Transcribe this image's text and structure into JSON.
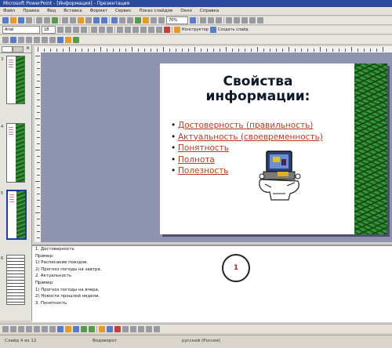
{
  "window": {
    "title": "Microsoft PowerPoint - [Информация] - Презентация"
  },
  "menu": [
    "Файл",
    "Правка",
    "Вид",
    "Вставка",
    "Формат",
    "Сервис",
    "Показ слайдов",
    "Окно",
    "Справка"
  ],
  "toolbar": {
    "zoom": "70%",
    "font": "Arial",
    "font_size": "18",
    "design_label": "Конструктор",
    "new_slide_label": "Создать слайд"
  },
  "left_panel": {
    "slide_numbers": [
      "3",
      "4",
      "5",
      "6"
    ]
  },
  "slide": {
    "title_line1": "Свойства",
    "title_line2": "информации:",
    "bullets": [
      "Достоверность (правильность)",
      "Актуальность (своевременность)",
      "Понятность",
      "Полнота",
      "Полезность"
    ]
  },
  "notes": {
    "lines": [
      "1. Достоверность",
      "Пример:",
      "1) Расписание поездов.",
      "2) Прогноз погоды на завтра.",
      "2. Актуальность",
      "Пример:",
      "1) Прогноз погоды на вчера.",
      "2) Новости прошлой недели.",
      "3. Понятность"
    ],
    "circle_label": "1"
  },
  "status": {
    "slide": "Слайд 4 из 12",
    "design": "Водоворот",
    "language": "русский (Россия)"
  },
  "colors": {
    "workspace": "#8e94b0",
    "bullet_text": "#c03a20",
    "title": "#0d1a2a"
  }
}
